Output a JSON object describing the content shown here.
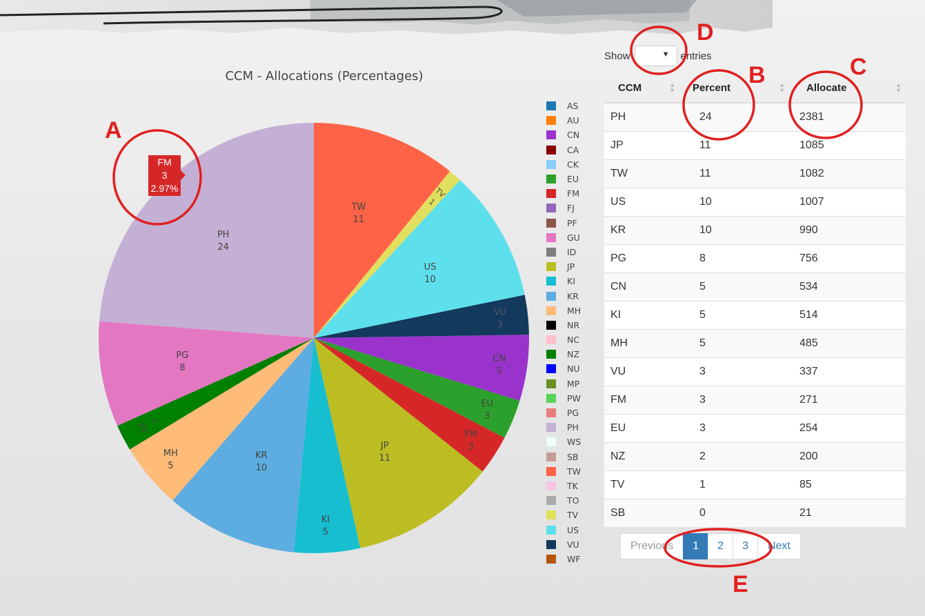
{
  "chart": {
    "title": "CCM - Allocations (Percentages)"
  },
  "chart_data": {
    "type": "pie",
    "title": "CCM - Allocations (Percentages)",
    "slices": [
      {
        "label": "PH",
        "value": 24,
        "color": "#c5b0d5"
      },
      {
        "label": "PG",
        "value": 8,
        "color": "#e377c2"
      },
      {
        "label": "NZ",
        "value": 2,
        "color": "#008000"
      },
      {
        "label": "MH",
        "value": 5,
        "color": "#ffbb78"
      },
      {
        "label": "KR",
        "value": 10,
        "color": "#5dade2"
      },
      {
        "label": "KI",
        "value": 5,
        "color": "#17becf"
      },
      {
        "label": "JP",
        "value": 11,
        "color": "#bcbd22"
      },
      {
        "label": "FM",
        "value": 3,
        "color": "#d62728"
      },
      {
        "label": "EU",
        "value": 3,
        "color": "#2ca02c"
      },
      {
        "label": "CN",
        "value": 5,
        "color": "#9933cc"
      },
      {
        "label": "VU",
        "value": 3,
        "color": "#13395d"
      },
      {
        "label": "US",
        "value": 10,
        "color": "#5ee0ec"
      },
      {
        "label": "TV",
        "value": 1,
        "color": "#e1e05e"
      },
      {
        "label": "TW",
        "value": 11,
        "color": "#ff6347"
      }
    ],
    "hover": {
      "label": "FM",
      "value": "3",
      "percent": "2.97%"
    }
  },
  "legend": [
    {
      "label": "AS",
      "color": "#1f77b4"
    },
    {
      "label": "AU",
      "color": "#ff7f0e"
    },
    {
      "label": "CN",
      "color": "#9933cc"
    },
    {
      "label": "CA",
      "color": "#8b0000"
    },
    {
      "label": "CK",
      "color": "#87cefa"
    },
    {
      "label": "EU",
      "color": "#2ca02c"
    },
    {
      "label": "FM",
      "color": "#d62728"
    },
    {
      "label": "FJ",
      "color": "#9467bd"
    },
    {
      "label": "PF",
      "color": "#8c564b"
    },
    {
      "label": "GU",
      "color": "#e377c2"
    },
    {
      "label": "ID",
      "color": "#7f7f7f"
    },
    {
      "label": "JP",
      "color": "#bcbd22"
    },
    {
      "label": "KI",
      "color": "#17becf"
    },
    {
      "label": "KR",
      "color": "#5dade2"
    },
    {
      "label": "MH",
      "color": "#ffbb78"
    },
    {
      "label": "NR",
      "color": "#000000"
    },
    {
      "label": "NC",
      "color": "#ffc0cb"
    },
    {
      "label": "NZ",
      "color": "#008000"
    },
    {
      "label": "NU",
      "color": "#0000ff"
    },
    {
      "label": "MP",
      "color": "#6b8e23"
    },
    {
      "label": "PW",
      "color": "#5ad45a"
    },
    {
      "label": "PG",
      "color": "#e87b7b"
    },
    {
      "label": "PH",
      "color": "#c5b0d5"
    },
    {
      "label": "WS",
      "color": "#f0ffff"
    },
    {
      "label": "SB",
      "color": "#c49c94"
    },
    {
      "label": "TW",
      "color": "#ff6347"
    },
    {
      "label": "TK",
      "color": "#f7c6e4"
    },
    {
      "label": "TO",
      "color": "#aaaaaa"
    },
    {
      "label": "TV",
      "color": "#e1e05e"
    },
    {
      "label": "US",
      "color": "#5ee0ec"
    },
    {
      "label": "VU",
      "color": "#13395d"
    },
    {
      "label": "WF",
      "color": "#b5560a"
    }
  ],
  "controls": {
    "show_label": "Show",
    "entries_label": "entries",
    "select_value": ""
  },
  "table": {
    "headers": [
      "CCM",
      "Percent",
      "Allocate"
    ],
    "rows": [
      [
        "PH",
        "24",
        "2381"
      ],
      [
        "JP",
        "11",
        "1085"
      ],
      [
        "TW",
        "11",
        "1082"
      ],
      [
        "US",
        "10",
        "1007"
      ],
      [
        "KR",
        "10",
        "990"
      ],
      [
        "PG",
        "8",
        "756"
      ],
      [
        "CN",
        "5",
        "534"
      ],
      [
        "KI",
        "5",
        "514"
      ],
      [
        "MH",
        "5",
        "485"
      ],
      [
        "VU",
        "3",
        "337"
      ],
      [
        "FM",
        "3",
        "271"
      ],
      [
        "EU",
        "3",
        "254"
      ],
      [
        "NZ",
        "2",
        "200"
      ],
      [
        "TV",
        "1",
        "85"
      ],
      [
        "SB",
        "0",
        "21"
      ]
    ]
  },
  "pagination": {
    "previous": "Previous",
    "pages": [
      "1",
      "2",
      "3"
    ],
    "next": "Next"
  },
  "annotations": {
    "A": "A",
    "B": "B",
    "C": "C",
    "D": "D",
    "E": "E",
    "color": "#e02020"
  }
}
